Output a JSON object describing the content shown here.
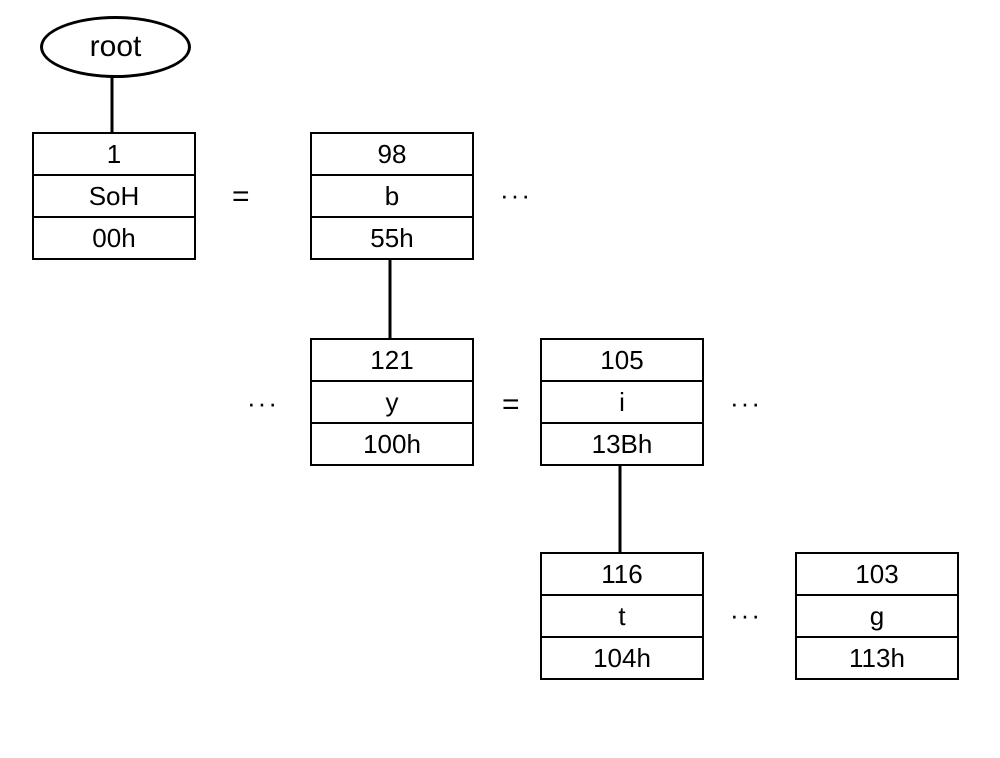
{
  "root": {
    "label": "root"
  },
  "nodes": {
    "n1": {
      "code": "1",
      "char": "SoH",
      "addr": "00h"
    },
    "n2": {
      "code": "98",
      "char": "b",
      "addr": "55h"
    },
    "n3": {
      "code": "121",
      "char": "y",
      "addr": "100h"
    },
    "n4": {
      "code": "105",
      "char": "i",
      "addr": "13Bh"
    },
    "n5": {
      "code": "116",
      "char": "t",
      "addr": "104h"
    },
    "n6": {
      "code": "103",
      "char": "g",
      "addr": "113h"
    }
  },
  "symbols": {
    "eq": "=",
    "dots": "···"
  }
}
